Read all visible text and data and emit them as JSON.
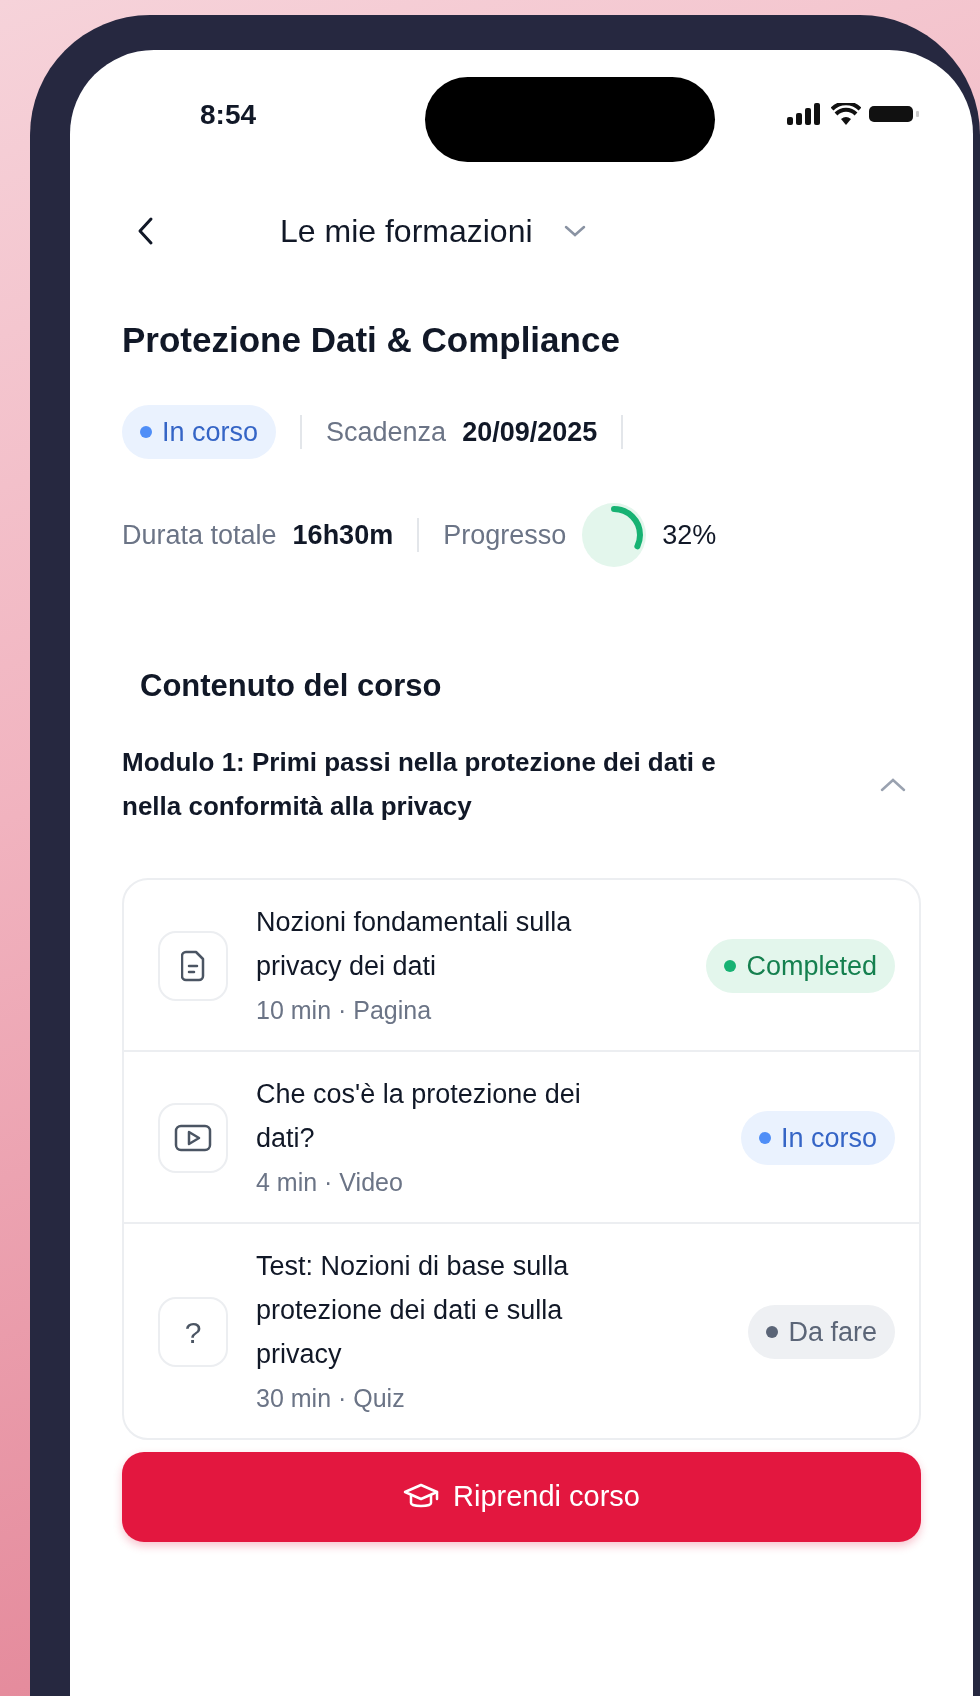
{
  "status_bar": {
    "time": "8:54"
  },
  "header": {
    "title": "Le mie formazioni"
  },
  "course": {
    "title": "Protezione Dati & Compliance",
    "status": {
      "label": "In corso",
      "kind": "in_progress"
    },
    "deadline_label": "Scadenza",
    "deadline": "20/09/2025",
    "duration_label": "Durata totale",
    "duration": "16h30m",
    "progress_label": "Progresso",
    "progress": {
      "level": 0.32
    },
    "progress_reading": "32%"
  },
  "section_title": "Contenuto del corso",
  "module": {
    "title": "Modulo 1: Primi passi nella protezione dei dati e nella conformità alla privacy",
    "expanded": true,
    "lessons": [
      {
        "kind": "page",
        "title": "Nozioni fondamentali sulla privacy dei dati",
        "meta": "10 min · Pagina",
        "status": {
          "label": "Completed",
          "kind": "completed"
        }
      },
      {
        "kind": "video",
        "title": "Che cos'è la protezione dei dati?",
        "meta": "4 min · Video",
        "status": {
          "label": "In corso",
          "kind": "in_progress"
        }
      },
      {
        "kind": "quiz",
        "icon": "?",
        "title": "Test: Nozioni di base sulla protezione dei dati e sulla privacy",
        "meta": "30 min · Quiz",
        "status": {
          "label": "Da fare",
          "kind": "todo"
        }
      }
    ]
  },
  "resume_button": {
    "label": "Riprendi corso"
  }
}
